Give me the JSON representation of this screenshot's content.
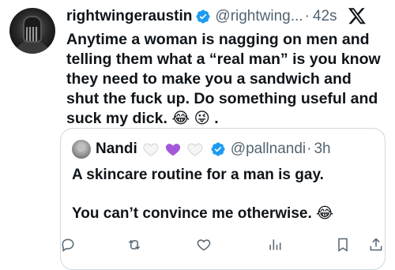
{
  "tweet": {
    "display_name": "rightwingeraustin",
    "handle": "@rightwing...",
    "separator": "·",
    "time": "42s",
    "text": "Anytime a woman is nagging on men and telling them what a “real man”  is you know they need to make you a sandwich and shut the fuck up.  Do something useful and suck my dick. 😂 😜 ."
  },
  "quoted": {
    "display_name": "Nandi",
    "hearts": [
      "white-heart",
      "purple-heart",
      "white-heart"
    ],
    "handle": "@pallnandi",
    "separator": "·",
    "time": "3h",
    "line1": "A skincare routine for a man is gay.",
    "line2": "You can’t convince me otherwise. 😂"
  },
  "icons": {
    "verified_color": "#1d9bf0",
    "brand": "x-logo"
  },
  "colors": {
    "text": "#0f1419",
    "secondary": "#536471",
    "border": "#cfd9de",
    "purple_heart": "#a259d9"
  }
}
